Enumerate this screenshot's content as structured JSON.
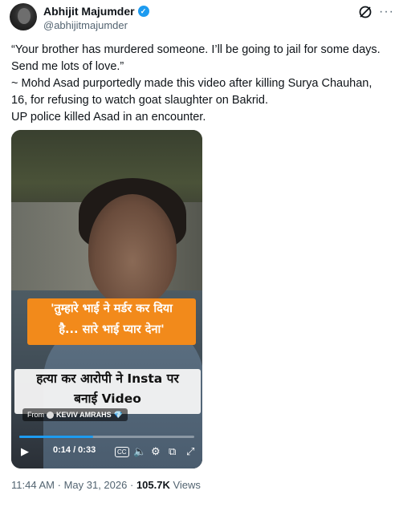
{
  "author": {
    "name": "Abhijit Majumder",
    "handle": "@abhijitmajumder",
    "verified_mark": "✓"
  },
  "header_icons": {
    "grok": "grok-icon",
    "more": "···"
  },
  "tweet": {
    "lines": [
      "“Your brother has murdered someone. I’ll be going to jail for some days.",
      "Send me lots of love.”",
      "~ Mohd Asad purportedly made this video after killing Surya Chauhan,",
      "16, for refusing to watch goat slaughter on Bakrid.",
      "UP police killed Asad in an encounter."
    ]
  },
  "media": {
    "caption_top_line1": "'तुम्हारे भाई ने मर्डर कर दिया",
    "caption_top_line2": "है... सारे भाई प्यार देना'",
    "caption_bottom_line1": "हत्या कर आरोपी ने Insta पर",
    "caption_bottom_line2": "बनाई Video",
    "from_label": "From",
    "from_source": "KEVIV AMRAHS",
    "progress_fraction": 0.424,
    "time_display": "0:14 / 0:33",
    "controls": {
      "play": "▶",
      "captions": "CC",
      "volume": "🔈",
      "settings": "⚙",
      "pip": "⧉",
      "fullscreen": "⤢"
    }
  },
  "meta": {
    "time": "11:44 AM",
    "sep1": "·",
    "date": "May 31, 2026",
    "sep2": "·",
    "views_count": "105.7K",
    "views_label": "Views"
  },
  "colors": {
    "accent": "#1d9bf0",
    "caption_orange": "#f28a1b",
    "secondary_text": "#536471"
  }
}
